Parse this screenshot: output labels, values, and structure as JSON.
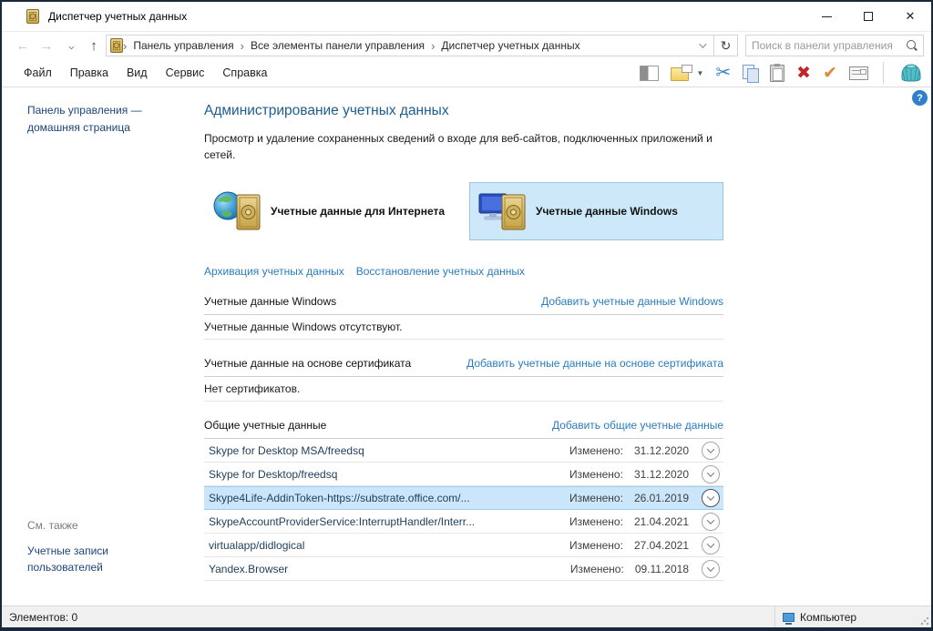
{
  "window": {
    "title": "Диспетчер учетных данных"
  },
  "glyphs": {
    "back": "←",
    "forward": "→",
    "up": "↑",
    "refresh": "↻",
    "crumb_sep": "›",
    "dropdown": "▼",
    "cut": "✂",
    "delete": "✖",
    "check": "✔",
    "close": "✕",
    "help": "?"
  },
  "address": {
    "crumbs": [
      "Панель управления",
      "Все элементы панели управления",
      "Диспетчер учетных данных"
    ]
  },
  "search": {
    "placeholder": "Поиск в панели управления"
  },
  "menu": {
    "items": [
      "Файл",
      "Правка",
      "Вид",
      "Сервис",
      "Справка"
    ]
  },
  "sidebar": {
    "home": "Панель управления — домашняя страница",
    "see_also": "См. также",
    "user_accounts": "Учетные записи пользователей"
  },
  "main": {
    "title": "Администрирование учетных данных",
    "description": "Просмотр и удаление сохраненных сведений о входе для веб-сайтов, подключенных приложений и сетей.",
    "tile_internet": "Учетные данные для Интернета",
    "tile_windows": "Учетные данные Windows",
    "backup_link": "Архивация учетных данных",
    "restore_link": "Восстановление учетных данных"
  },
  "sections": {
    "windows": {
      "title": "Учетные данные Windows",
      "action": "Добавить учетные данные Windows",
      "empty": "Учетные данные Windows отсутствуют."
    },
    "cert": {
      "title": "Учетные данные на основе сертификата",
      "action": "Добавить учетные данные на основе сертификата",
      "empty": "Нет сертификатов."
    },
    "generic": {
      "title": "Общие учетные данные",
      "action": "Добавить общие учетные данные"
    }
  },
  "credentials": {
    "modified_label": "Изменено:",
    "items": [
      {
        "name": "Skype for Desktop MSA/freedsq",
        "date": "31.12.2020"
      },
      {
        "name": "Skype for Desktop/freedsq",
        "date": "31.12.2020"
      },
      {
        "name": "Skype4Life-AddinToken-https://substrate.office.com/...",
        "date": "26.01.2019"
      },
      {
        "name": "SkypeAccountProviderService:InterruptHandler/Interr...",
        "date": "21.04.2021"
      },
      {
        "name": "virtualapp/didlogical",
        "date": "27.04.2021"
      },
      {
        "name": "Yandex.Browser",
        "date": "09.11.2018"
      }
    ]
  },
  "statusbar": {
    "items": "Элементов: 0",
    "computer": "Компьютер"
  }
}
